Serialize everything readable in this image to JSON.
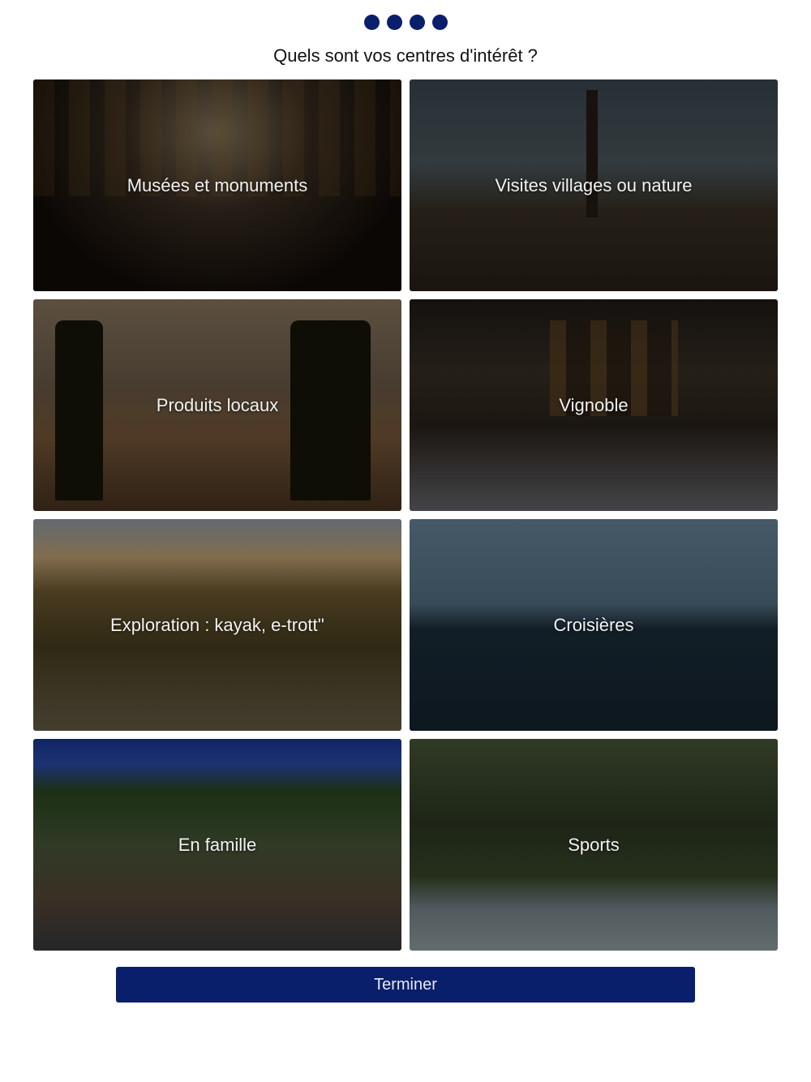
{
  "progress": {
    "steps_total": 4,
    "steps_visible": 4
  },
  "question": "Quels sont vos centres d'intérêt ?",
  "interests": [
    {
      "label": "Musées et monuments",
      "image": "museum-gallery-photo"
    },
    {
      "label": "Visites villages ou nature",
      "image": "village-rooftops-photo"
    },
    {
      "label": "Produits locaux",
      "image": "olive-oil-market-photo"
    },
    {
      "label": "Vignoble",
      "image": "wine-tasting-photo"
    },
    {
      "label": "Exploration : kayak, e-trott''",
      "image": "e-bike-riders-photo"
    },
    {
      "label": "Croisières",
      "image": "boat-on-sea-photo"
    },
    {
      "label": "En famille",
      "image": "canal-family-photo"
    },
    {
      "label": "Sports",
      "image": "windsurf-photo"
    }
  ],
  "finish_button": {
    "label": "Terminer"
  },
  "colors": {
    "primary": "#0a1f6b",
    "background": "#ffffff",
    "card_text": "#f2f2f2"
  }
}
